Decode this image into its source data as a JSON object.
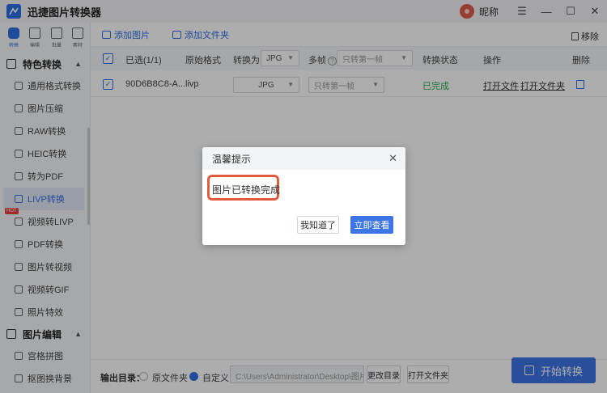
{
  "app": {
    "title": "迅捷图片转换器",
    "nickname": "昵称"
  },
  "window_controls": [
    "minimize",
    "restore",
    "maximize",
    "close"
  ],
  "topnav": [
    {
      "label": "转换",
      "icon": "convert-icon",
      "active": true
    },
    {
      "label": "编辑",
      "icon": "edit-icon"
    },
    {
      "label": "批量",
      "icon": "batch-icon"
    },
    {
      "label": "素材",
      "icon": "material-icon"
    }
  ],
  "sidebar": {
    "section1": "特色转换",
    "items": [
      {
        "label": "通用格式转换"
      },
      {
        "label": "图片压缩"
      },
      {
        "label": "RAW转换"
      },
      {
        "label": "HEIC转换"
      },
      {
        "label": "转为PDF"
      },
      {
        "label": "LIVP转换",
        "active": true
      },
      {
        "label": "视频转LIVP",
        "badge": "HOT"
      },
      {
        "label": "PDF转换"
      },
      {
        "label": "图片转视频"
      },
      {
        "label": "视频转GIF"
      },
      {
        "label": "照片特效"
      }
    ],
    "section2": "图片编辑",
    "items2": [
      {
        "label": "宫格拼图"
      },
      {
        "label": "抠图换背景"
      }
    ]
  },
  "toolbar": {
    "add_image": "添加图片",
    "add_folder": "添加文件夹",
    "remove": "移除"
  },
  "table": {
    "header": {
      "selected": "已选(1/1)",
      "orig_format": "原始格式",
      "convert_to": "转换为",
      "convert_to_value": "JPG",
      "multi_frame": "多帧",
      "multi_frame_value": "只转第一帧",
      "status": "转换状态",
      "actions": "操作",
      "delete": "删除"
    },
    "rows": [
      {
        "name": "90D6B8C8-A...",
        "format": "livp",
        "target": "JPG",
        "frames": "只转第一帧",
        "status": "已完成",
        "open_file": "打开文件",
        "open_folder": "打开文件夹"
      }
    ]
  },
  "bottom": {
    "output_label": "输出目录：",
    "orig_folder": "原文件夹",
    "custom": "自定义",
    "path": "C:\\Users\\Administrator\\Desktop\\图片",
    "change_dir": "更改目录",
    "open_folder": "打开文件夹",
    "start": "开始转换"
  },
  "dialog": {
    "title": "温馨提示",
    "message": "图片已转换完成",
    "ok": "我知道了",
    "view": "立即查看"
  },
  "colors": {
    "accent": "#3d75e6",
    "success": "#2eaa4e",
    "highlight": "#e25b3c"
  }
}
